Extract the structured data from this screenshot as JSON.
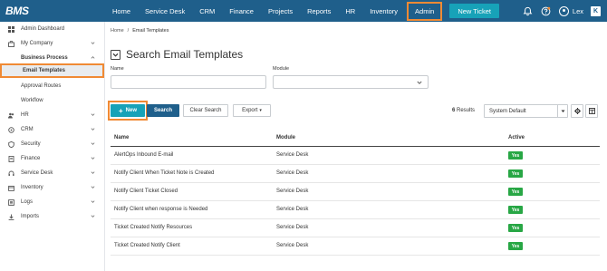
{
  "app": {
    "logo": "BMS"
  },
  "nav": {
    "items": [
      "Home",
      "Service Desk",
      "CRM",
      "Finance",
      "Projects",
      "Reports",
      "HR",
      "Inventory",
      "Admin"
    ],
    "new_ticket": "New Ticket",
    "user": "Lex",
    "badge_icon": "K"
  },
  "sidebar": {
    "items": [
      {
        "label": "Admin Dashboard",
        "icon": "grid-icon"
      },
      {
        "label": "My Company",
        "icon": "briefcase-icon"
      },
      {
        "label": "Business Process",
        "icon": ""
      },
      {
        "label": "Email Templates",
        "icon": ""
      },
      {
        "label": "Approval Routes",
        "icon": ""
      },
      {
        "label": "Workflow",
        "icon": ""
      },
      {
        "label": "HR",
        "icon": "people-icon"
      },
      {
        "label": "CRM",
        "icon": "crm-icon"
      },
      {
        "label": "Security",
        "icon": "shield-icon"
      },
      {
        "label": "Finance",
        "icon": "document-icon"
      },
      {
        "label": "Service Desk",
        "icon": "headset-icon"
      },
      {
        "label": "Inventory",
        "icon": "box-icon"
      },
      {
        "label": "Logs",
        "icon": "list-icon"
      },
      {
        "label": "Imports",
        "icon": "import-icon"
      }
    ]
  },
  "breadcrumb": {
    "home": "Home",
    "sep": "/",
    "current": "Email Templates"
  },
  "page": {
    "title": "Search Email Templates"
  },
  "filters": {
    "name_label": "Name",
    "name_value": "",
    "module_label": "Module",
    "module_value": ""
  },
  "toolbar": {
    "new_label": "New",
    "search_label": "Search",
    "clear_label": "Clear Search",
    "export_label": "Export",
    "results_count": "6",
    "results_label": "Results",
    "view_select": "System Default"
  },
  "table": {
    "headers": [
      "Name",
      "Module",
      "Active"
    ],
    "rows": [
      {
        "name": "AlertOps Inbound E-mail",
        "module": "Service Desk",
        "active": "Yes"
      },
      {
        "name": "Notify Client When Ticket Note is Created",
        "module": "Service Desk",
        "active": "Yes"
      },
      {
        "name": "Notify Client Ticket Closed",
        "module": "Service Desk",
        "active": "Yes"
      },
      {
        "name": "Notify Client when response is Needed",
        "module": "Service Desk",
        "active": "Yes"
      },
      {
        "name": "Ticket Created Notify Resources",
        "module": "Service Desk",
        "active": "Yes"
      },
      {
        "name": "Ticket Created Notify Client",
        "module": "Service Desk",
        "active": "Yes"
      }
    ]
  },
  "colors": {
    "nav_bg": "#1f5f8b",
    "accent": "#17a2b8",
    "highlight": "#f08a34",
    "active_badge": "#28a745"
  }
}
